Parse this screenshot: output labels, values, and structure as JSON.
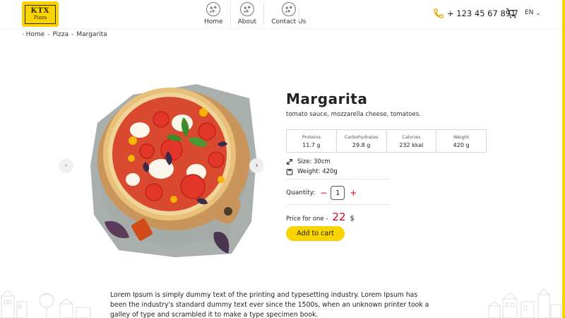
{
  "brand": {
    "logo_line1": "KTX",
    "logo_line2": "Pizza",
    "accent": "#f7d300",
    "price_color": "#d0021b"
  },
  "nav": {
    "items": [
      {
        "label": "Home",
        "icon": "pizza-icon"
      },
      {
        "label": "About",
        "icon": "pizza-icon"
      },
      {
        "label": "Contact Us",
        "icon": "pizza-icon"
      }
    ]
  },
  "header": {
    "phone": "+ 123 45 67 891",
    "phone_icon": "phone-icon",
    "cart_icon": "cart-icon",
    "language": "EN"
  },
  "breadcrumb": {
    "items": [
      "Home",
      "Pizza",
      "Margarita"
    ]
  },
  "product": {
    "title": "Margarita",
    "ingredients": "tomato sauce, mozzarella cheese, tomatoes.",
    "nutrition": [
      {
        "label": "Proteins",
        "value": "11.7 g"
      },
      {
        "label": "Carbohydrates",
        "value": "29.8 g"
      },
      {
        "label": "Calories",
        "value": "232 kkal"
      },
      {
        "label": "Weight",
        "value": "420 g"
      }
    ],
    "size_label": "Size:",
    "size_value": "30cm",
    "weight_label": "Weight:",
    "weight_value": "420g",
    "quantity_label": "Quantity:",
    "quantity_minus": "−",
    "quantity": "1",
    "quantity_plus": "+",
    "price_label": "Price for one -",
    "price": "22",
    "currency": "$",
    "add_to_cart": "Add to cart"
  },
  "gallery": {
    "prev_icon": "chevron-left-icon",
    "next_icon": "chevron-right-icon"
  },
  "description": "Lorem Ipsum is simply dummy text of the printing and typesetting industry. Lorem Ipsum has been the industry's standard dummy text ever since the 1500s, when an unknown printer took a galley of type and scrambled it to make a type specimen book."
}
